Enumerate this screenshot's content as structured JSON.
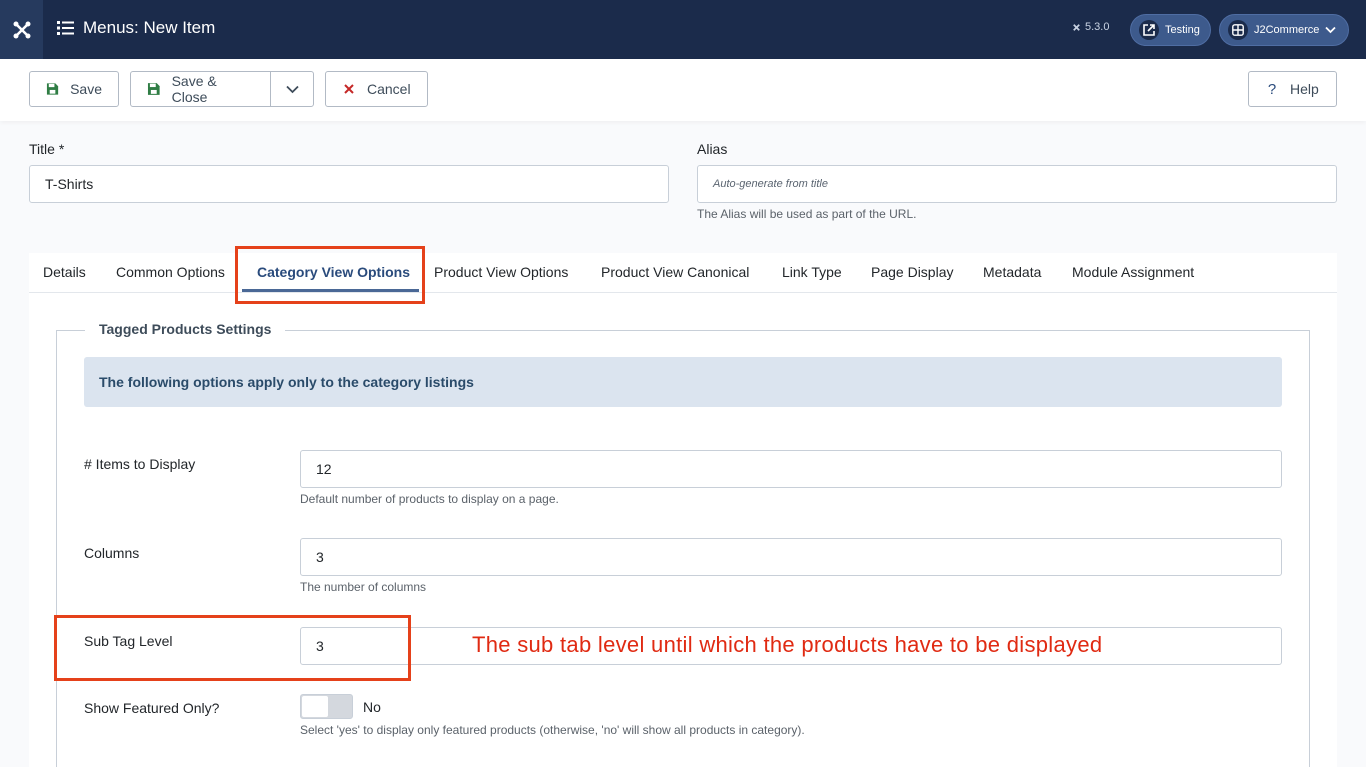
{
  "header": {
    "title": "Menus: New Item",
    "version": "5.3.0",
    "site_button": "Testing",
    "user_button": "J2Commerce"
  },
  "toolbar": {
    "save": "Save",
    "save_close": "Save & Close",
    "cancel": "Cancel",
    "help": "Help"
  },
  "form": {
    "title_label": "Title *",
    "title_value": "T-Shirts",
    "alias_label": "Alias",
    "alias_placeholder": "Auto-generate from title",
    "alias_hint": "The Alias will be used as part of the URL."
  },
  "tabs": [
    {
      "label": "Details"
    },
    {
      "label": "Common Options"
    },
    {
      "label": "Category View Options"
    },
    {
      "label": "Product View Options"
    },
    {
      "label": "Product View Canonical"
    },
    {
      "label": "Link Type"
    },
    {
      "label": "Page Display"
    },
    {
      "label": "Metadata"
    },
    {
      "label": "Module Assignment"
    }
  ],
  "active_tab": "Category View Options",
  "fieldset": {
    "legend": "Tagged Products Settings",
    "alert": "The following options apply only to the category listings",
    "fields": [
      {
        "label": "# Items to Display",
        "value": "12",
        "hint": "Default number of products to display on a page."
      },
      {
        "label": "Columns",
        "value": "3",
        "hint": "The number of columns"
      },
      {
        "label": "Sub Tag Level",
        "value": "3"
      },
      {
        "label": "Show Featured Only?",
        "value": "No",
        "hint": "Select 'yes' to display only featured products (otherwise, 'no' will show all products in category)."
      }
    ]
  },
  "annotation": "The sub tab level until which the products have to be displayed",
  "colors": {
    "header_bg": "#1b2b4b",
    "active_tab": "#2a4b7c",
    "highlight": "#e5411a",
    "annotation": "#e02a12"
  }
}
